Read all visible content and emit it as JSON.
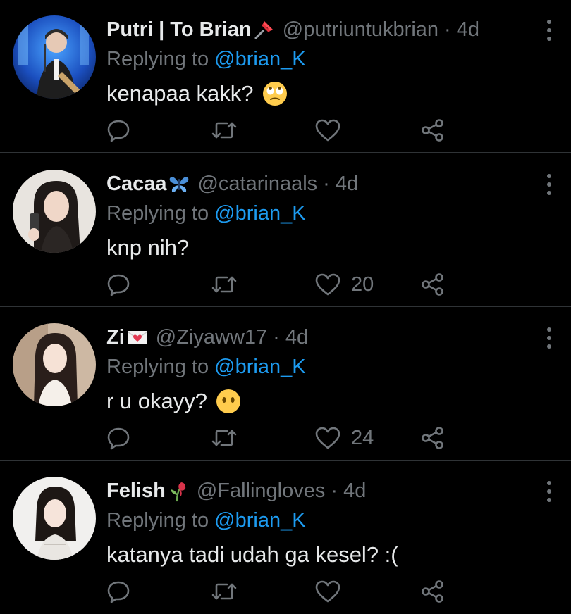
{
  "colors": {
    "background": "#000000",
    "primary_text": "#e7e9ea",
    "secondary_text": "#71767b",
    "link": "#1d9bf0",
    "divider": "#2f3336"
  },
  "tweets": [
    {
      "name": "Putri | To Brian",
      "name_emoji": "pushpin-icon",
      "handle": "@putriuntukbrian",
      "dot": "·",
      "time": "4d",
      "replying_prefix": "Replying to ",
      "replying_to": "@brian_K",
      "text": "kenapaa kakk?",
      "text_emoji": "face-with-rolling-eyes-icon",
      "likes": ""
    },
    {
      "name": "Cacaa",
      "name_emoji": "butterfly-icon",
      "handle": "@catarinaals",
      "dot": "·",
      "time": "4d",
      "replying_prefix": "Replying to ",
      "replying_to": "@brian_K",
      "text": "knp nih?",
      "text_emoji": "",
      "likes": "20"
    },
    {
      "name": "Zi",
      "name_emoji": "love-letter-icon",
      "handle": "@Ziyaww17",
      "dot": "·",
      "time": "4d",
      "replying_prefix": "Replying to ",
      "replying_to": "@brian_K",
      "text": "r u okayy?",
      "text_emoji": "face-without-mouth-icon",
      "likes": "24"
    },
    {
      "name": "Felish",
      "name_emoji": "wilted-flower-icon",
      "handle": "@Fallingloves",
      "dot": "·",
      "time": "4d",
      "replying_prefix": "Replying to ",
      "replying_to": "@brian_K",
      "text": "katanya tadi udah ga kesel? :(",
      "text_emoji": "",
      "likes": ""
    }
  ]
}
